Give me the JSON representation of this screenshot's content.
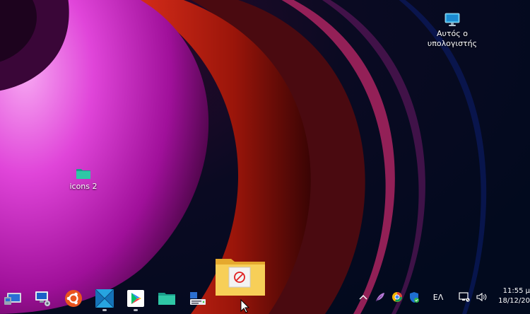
{
  "desktop": {
    "icons": [
      {
        "label_line1": "Αυτός ο",
        "label_line2": "υπολογιστής",
        "icon": "monitor-icon"
      },
      {
        "label_line1": "icons 2",
        "icon": "folder-icon"
      }
    ]
  },
  "drag_ghost": {
    "icon": "folder-icon",
    "badge": "no-drop-icon"
  },
  "taskbar": {
    "apps": [
      {
        "icon": "remote-desktop-icon"
      },
      {
        "icon": "network-computer-icon"
      },
      {
        "icon": "ubuntu-icon"
      },
      {
        "icon": "wsl-icon",
        "running": true
      },
      {
        "icon": "play-store-icon",
        "running": true
      },
      {
        "icon": "file-explorer-icon"
      },
      {
        "icon": "server-icon"
      }
    ],
    "tray": {
      "icons": [
        "chevron-up-icon",
        "feather-icon",
        "chrome-color-icon",
        "shield-icon",
        "network-icon",
        "volume-icon"
      ],
      "language": "ΕΛ",
      "time": "11:55 μ",
      "date": "18/12/20"
    }
  },
  "colors": {
    "wallpaper_dark": "#020a1e",
    "magenta": "#d11cc7",
    "red": "#b0190e",
    "folder_yellow": "#f5c84c"
  }
}
